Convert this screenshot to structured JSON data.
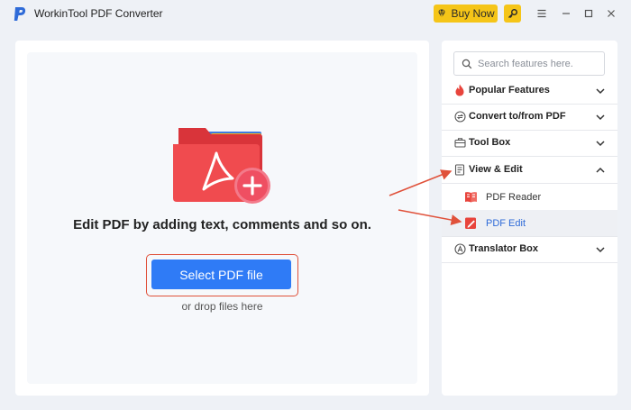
{
  "window": {
    "title": "WorkinTool PDF Converter",
    "buy_label": "Buy Now"
  },
  "main": {
    "description": "Edit PDF by adding text, comments and so on.",
    "select_button": "Select PDF file",
    "drop_hint": "or drop files here"
  },
  "sidebar": {
    "search_placeholder": "Search features here.",
    "sections": [
      {
        "label": "Popular Features",
        "expanded": false,
        "icon": "flame-icon"
      },
      {
        "label": "Convert to/from PDF",
        "expanded": false,
        "icon": "convert-icon"
      },
      {
        "label": "Tool Box",
        "expanded": false,
        "icon": "toolbox-icon"
      },
      {
        "label": "View & Edit",
        "expanded": true,
        "icon": "view-edit-icon",
        "items": [
          {
            "label": "PDF Reader",
            "icon": "pdf-reader-icon",
            "active": false
          },
          {
            "label": "PDF Edit",
            "icon": "pdf-edit-icon",
            "active": true
          }
        ]
      },
      {
        "label": "Translator Box",
        "expanded": false,
        "icon": "translator-icon"
      }
    ]
  },
  "colors": {
    "accent": "#2f7bf6",
    "highlight": "#e0513a",
    "buy": "#f5c518",
    "active_text": "#2f6bd8"
  }
}
